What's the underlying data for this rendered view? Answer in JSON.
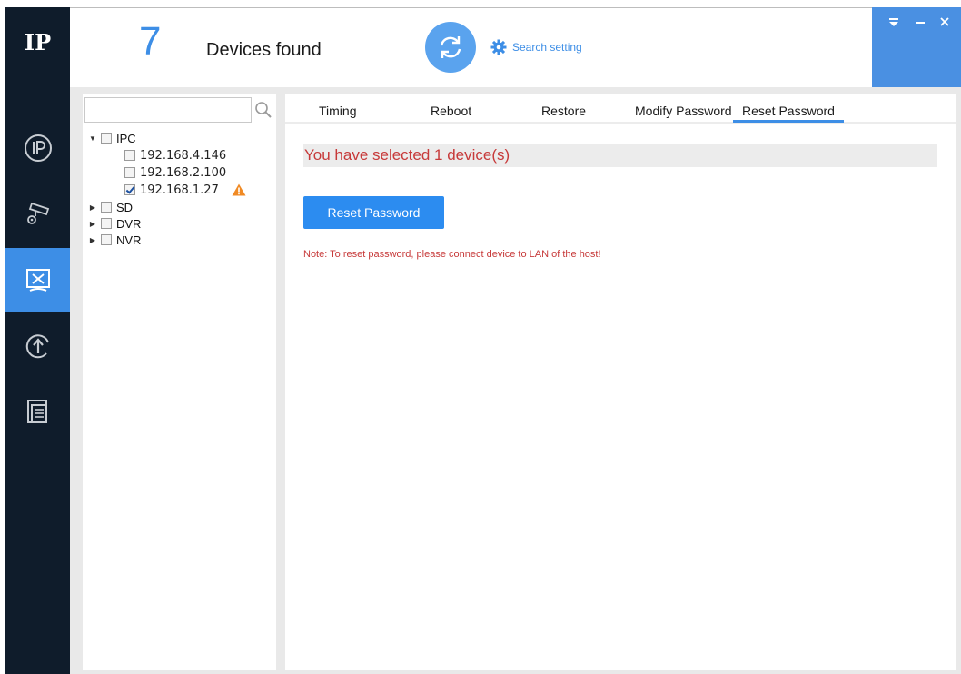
{
  "app": {
    "logo_text": "IP",
    "accent_color": "#3d8ee6",
    "sidebar_color": "#0f1c2b"
  },
  "sidebar": {
    "items": [
      {
        "icon": "ip-icon",
        "active": false
      },
      {
        "icon": "camera-settings-icon",
        "active": false
      },
      {
        "icon": "tools-icon",
        "active": true
      },
      {
        "icon": "upgrade-icon",
        "active": false
      },
      {
        "icon": "document-list-icon",
        "active": false
      }
    ]
  },
  "header": {
    "device_count": "7",
    "devices_found_label": "Devices found",
    "search_setting_label": "Search setting"
  },
  "tree": {
    "search_placeholder": "",
    "groups": [
      {
        "label": "IPC",
        "expanded": true,
        "children": [
          {
            "label": "192.168.4.146",
            "checked": false
          },
          {
            "label": "192.168.2.100",
            "checked": false
          },
          {
            "label": "192.168.1.27",
            "checked": true,
            "warning": true
          }
        ]
      },
      {
        "label": "SD",
        "expanded": false
      },
      {
        "label": "DVR",
        "expanded": false
      },
      {
        "label": "NVR",
        "expanded": false
      }
    ]
  },
  "tabs": [
    {
      "label": "Timing"
    },
    {
      "label": "Reboot"
    },
    {
      "label": "Restore"
    },
    {
      "label": "Modify Password"
    },
    {
      "label": "Reset Password",
      "active": true
    }
  ],
  "main": {
    "selected_text": "You have selected 1 device(s)",
    "reset_button_label": "Reset Password",
    "note_text": "Note: To reset password, please connect device to LAN of the host!"
  }
}
